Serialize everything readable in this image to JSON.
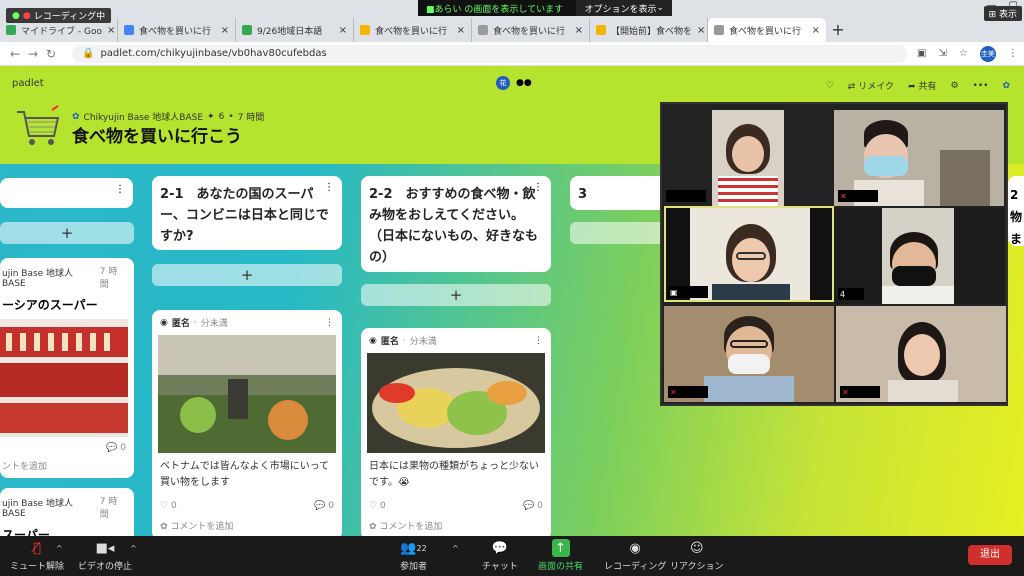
{
  "recording": {
    "label": "レコーディング中"
  },
  "share_banner": {
    "text": "あらい の画面を表示しています",
    "options": "オプションを表示"
  },
  "show_label": "表示",
  "tabs": [
    {
      "label": "マイドライブ - Goo",
      "color": "#34a853"
    },
    {
      "label": "食べ物を買いに行",
      "color": "#4285f4"
    },
    {
      "label": "9/26地域日本語",
      "color": "#34a853"
    },
    {
      "label": "食べ物を買いに行",
      "color": "#f4b400"
    },
    {
      "label": "食べ物を買いに行",
      "color": "#999999"
    },
    {
      "label": "【開始前】食べ物を",
      "color": "#f4b400"
    },
    {
      "label": "食べ物を買いに行",
      "color": "#999999"
    }
  ],
  "address": {
    "url": "padlet.com/chikyujinbase/vb0hav80cufebdas",
    "profile": "圭美"
  },
  "padlet": {
    "logo": "padlet",
    "center_avatar": "花",
    "remake": "リメイク",
    "share": "共有",
    "author": "Chikyujin Base 地球人BASE",
    "likes": "6",
    "time": "7 時間",
    "title": "食べ物を買いに行こう",
    "columns": [
      {
        "title": "2-1　あなたの国のスーパー、コンビニは日本と同じですか?"
      },
      {
        "title": "2-2　おすすめの食べ物・飲み物をおしえてください。（日本にないもの、好きなもの）"
      },
      {
        "title": "3"
      }
    ],
    "left_post1": {
      "author": "ujin Base 地球人BASE",
      "time": "7 時間",
      "title": "ーシアのスーパー",
      "comments": "0",
      "add_comment": "ントを追加"
    },
    "left_post2": {
      "author": "ujin Base 地球人BASE",
      "time": "7 時間",
      "title": "スーパー"
    },
    "post1": {
      "author": "匿名",
      "time": "分未満",
      "text": "ベトナムでは皆んなよく市場にいって買い物をします",
      "likes": "0",
      "comments": "0",
      "add_comment": "コメントを追加"
    },
    "post2": {
      "author": "匿名",
      "time": "分未満",
      "text": "日本には果物の種類がちょっと少ないです。😭",
      "likes": "0",
      "comments": "0",
      "add_comment": "コメントを追加"
    },
    "right_edge": {
      "num": "2",
      "text1": "物",
      "text2": "ま"
    }
  },
  "participants_count": "4",
  "toolbar": {
    "mute": "ミュート解除",
    "video": "ビデオの停止",
    "participants": "参加者",
    "participants_count": "22",
    "chat": "チャット",
    "share": "画面の共有",
    "record": "レコーディング",
    "reaction": "リアクション",
    "exit": "退出"
  }
}
